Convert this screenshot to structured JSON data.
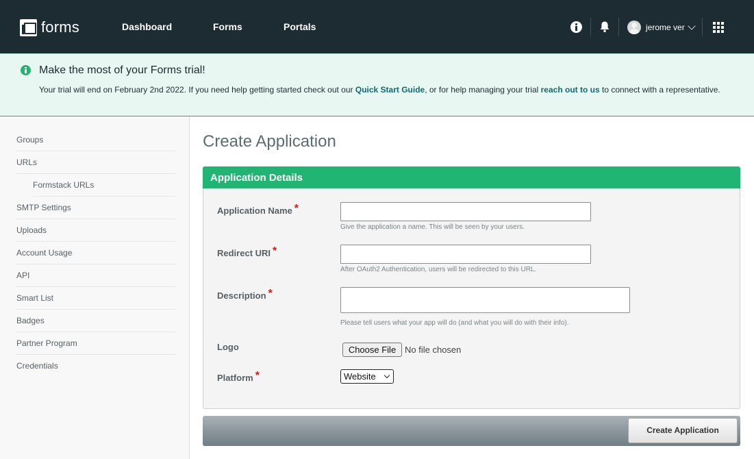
{
  "header": {
    "logo_text": "forms",
    "nav": [
      "Dashboard",
      "Forms",
      "Portals"
    ],
    "user_name": "jerome ver"
  },
  "banner": {
    "title": "Make the most of your Forms trial!",
    "text_1": "Your trial will end on February 2nd 2022. If you need help getting started check out our ",
    "link_1": "Quick Start Guide",
    "text_2": ", or for help managing your trial ",
    "link_2": "reach out to us",
    "text_3": " to connect with a representative."
  },
  "sidebar": {
    "items": [
      "Groups",
      "URLs",
      "Formstack URLs",
      "SMTP Settings",
      "Uploads",
      "Account Usage",
      "API",
      "Smart List",
      "Badges",
      "Partner Program",
      "Credentials"
    ]
  },
  "main": {
    "title": "Create Application",
    "panel_title": "Application Details",
    "fields": {
      "app_name_label": "Application Name",
      "app_name_value": "",
      "app_name_hint": "Give the application a name. This will be seen by your users.",
      "redirect_label": "Redirect URI",
      "redirect_value": "",
      "redirect_hint": "After OAuth2 Authentication, users will be redirected to this URL.",
      "description_label": "Description",
      "description_value": "",
      "description_hint": "Please tell users what your app will do (and what you will do with their info).",
      "logo_label": "Logo",
      "file_button": "Choose File",
      "file_status": "No file chosen",
      "platform_label": "Platform",
      "platform_selected": "Website",
      "required_mark": "*"
    },
    "submit_label": "Create Application"
  },
  "colors": {
    "topbar": "#1d2b33",
    "accent_green": "#21b573",
    "banner_bg": "#e8f7f2",
    "link": "#0b6b74",
    "required": "#c0201e"
  }
}
